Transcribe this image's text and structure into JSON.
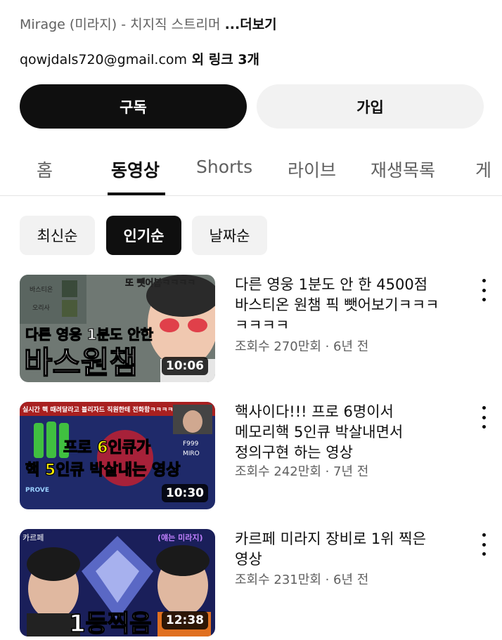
{
  "channel": {
    "description_preview": "Mirage (미라지) - 치지직 스트리머 ",
    "more_label": "...더보기",
    "link_email": "qowjdals720@gmail.com",
    "link_suffix": " 외 링크 3개"
  },
  "buttons": {
    "subscribe": "구독",
    "join": "가입"
  },
  "tabs": [
    "홈",
    "동영상",
    "Shorts",
    "라이브",
    "재생목록",
    "게"
  ],
  "active_tab": "동영상",
  "sort_chips": [
    "최신순",
    "인기순",
    "날짜순"
  ],
  "active_chip": "인기순",
  "videos": [
    {
      "title_lines": [
        "다른 영웅 1분도 안 한 4500점",
        "바스티온 원챔 픽 뺏어보기ㅋㅋㅋ",
        "ㅋㅋㅋㅋ"
      ],
      "meta": "조회수 270만회 · 6년 전",
      "duration": "10:06",
      "thumb_text": [
        "다른 영웅 1분도 안한",
        "바스원챔"
      ],
      "thumb_caption": "또 뺏어봄ㅋㅋㅋㅋ",
      "thumb_labels": [
        "바스티온",
        "오리사"
      ]
    },
    {
      "title_lines": [
        "핵사이다!!! 프로 6명이서",
        "메모리핵 5인큐 박살내면서",
        "정의구현 하는 영상"
      ],
      "meta": "조회수 242만회 · 7년 전",
      "duration": "10:30",
      "thumb_text": [
        "프로 6인큐가",
        "핵 5인큐 박살내는 영상"
      ],
      "thumb_caption": "실시간 핵 때려달라고 블리자드 직원한테 전화함ㅋㅋㅋㅋ",
      "thumb_labels": [
        "PROVE",
        "MIRO",
        "F999"
      ]
    },
    {
      "title_lines": [
        "카르페 미라지 장비로 1위 찍은",
        "영상"
      ],
      "meta": "조회수 231만회 · 6년 전",
      "duration": "12:38",
      "thumb_text": [
        "1등찍음"
      ],
      "thumb_caption": "(얘는 미라지)",
      "thumb_labels": [
        "카르페"
      ]
    }
  ],
  "colors": {
    "text_primary": "#0f0f0f",
    "text_secondary": "#606060",
    "chip_bg": "#f2f2f2",
    "active_bg": "#0f0f0f"
  }
}
